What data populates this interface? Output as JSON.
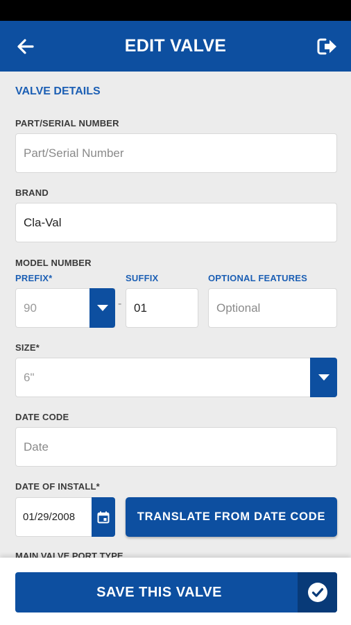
{
  "header": {
    "title": "EDIT VALVE",
    "back_icon": "arrow-left-icon",
    "logout_icon": "logout-icon"
  },
  "form": {
    "section_title": "VALVE DETAILS",
    "part_serial": {
      "label": "PART/SERIAL NUMBER",
      "placeholder": "Part/Serial Number",
      "value": ""
    },
    "brand": {
      "label": "BRAND",
      "value": "Cla-Val"
    },
    "model_number": {
      "label": "MODEL NUMBER",
      "prefix": {
        "label": "PREFIX*",
        "value": "90"
      },
      "separator": "-",
      "suffix": {
        "label": "SUFFIX",
        "value": "01"
      },
      "optional_features": {
        "label": "OPTIONAL FEATURES",
        "placeholder": "Optional",
        "value": ""
      }
    },
    "size": {
      "label": "SIZE*",
      "value": "6\""
    },
    "date_code": {
      "label": "DATE CODE",
      "placeholder": "Date",
      "value": ""
    },
    "date_of_install": {
      "label": "DATE OF INSTALL*",
      "value": "01/29/2008",
      "icon": "calendar-icon"
    },
    "translate_button": "TRANSLATE FROM DATE CODE",
    "main_valve_port_type": {
      "label": "MAIN VALVE PORT TYPE"
    }
  },
  "footer": {
    "save_label": "SAVE THIS VALVE",
    "save_icon": "check-circle-icon"
  },
  "colors": {
    "primary": "#0d4fa0",
    "primary_dark": "#083a78",
    "accent_text": "#1c5fb4",
    "background": "#ececec"
  }
}
